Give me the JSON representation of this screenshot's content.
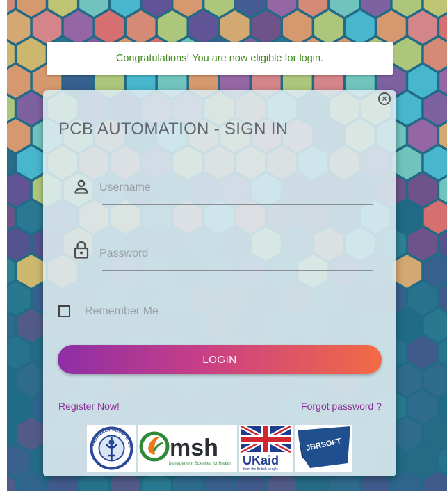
{
  "notice": {
    "text": "Congratulations! You are now eligible for login."
  },
  "login_card": {
    "title": "PCB AUTOMATION - SIGN IN",
    "close_icon": "close-circle-icon",
    "username": {
      "placeholder": "Username",
      "value": "",
      "icon": "user-icon"
    },
    "password": {
      "placeholder": "Password",
      "value": "",
      "icon": "lock-icon"
    },
    "remember_me": {
      "label": "Remember Me",
      "checked": false
    },
    "login_button": "LOGIN",
    "register_link": "Register Now!",
    "forgot_link": "Forgot password ?"
  },
  "logos": {
    "pcb": {
      "text": "PHARMACY COUNCIL OF BANGLADESH"
    },
    "msh": {
      "name": "msh",
      "tagline": "Management Sciences for Health"
    },
    "ukaid": {
      "name": "UKaid",
      "tagline": "from the British people"
    },
    "jbrsoft": {
      "name": "JBRSOFT"
    }
  },
  "colors": {
    "notice_text": "#3f8a1d",
    "link": "#8a2e98",
    "button_start": "#8e2ea6",
    "button_end": "#f36b44",
    "background": "#226a86"
  }
}
